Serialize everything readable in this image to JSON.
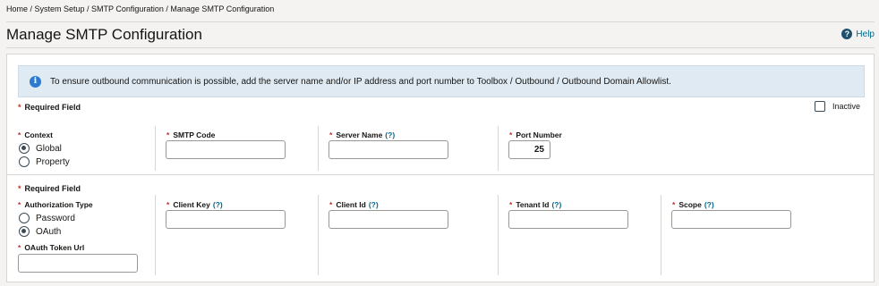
{
  "breadcrumb": "Home / System Setup / SMTP Configuration / Manage SMTP Configuration",
  "page_title": "Manage SMTP Configuration",
  "help_label": "Help",
  "banner_text": "To ensure outbound communication is possible, add the server name and/or IP address and port number to Toolbox / Outbound / Outbound Domain Allowlist.",
  "required_field_label": "Required Field",
  "inactive_label": "Inactive",
  "section1": {
    "context_label": "Context",
    "context_options": [
      "Global",
      "Property"
    ],
    "context_selected": "Global",
    "smtp_code_label": "SMTP Code",
    "smtp_code_value": "",
    "server_name_label": "Server Name",
    "port_number_label": "Port Number",
    "port_number_value": "25"
  },
  "section2": {
    "auth_type_label": "Authorization Type",
    "auth_options": [
      "Password",
      "OAuth"
    ],
    "auth_selected": "OAuth",
    "oauth_token_url_label": "OAuth Token Url",
    "client_key_label": "Client Key",
    "client_id_label": "Client Id",
    "tenant_id_label": "Tenant Id",
    "scope_label": "Scope"
  },
  "help_marker": "(?)"
}
